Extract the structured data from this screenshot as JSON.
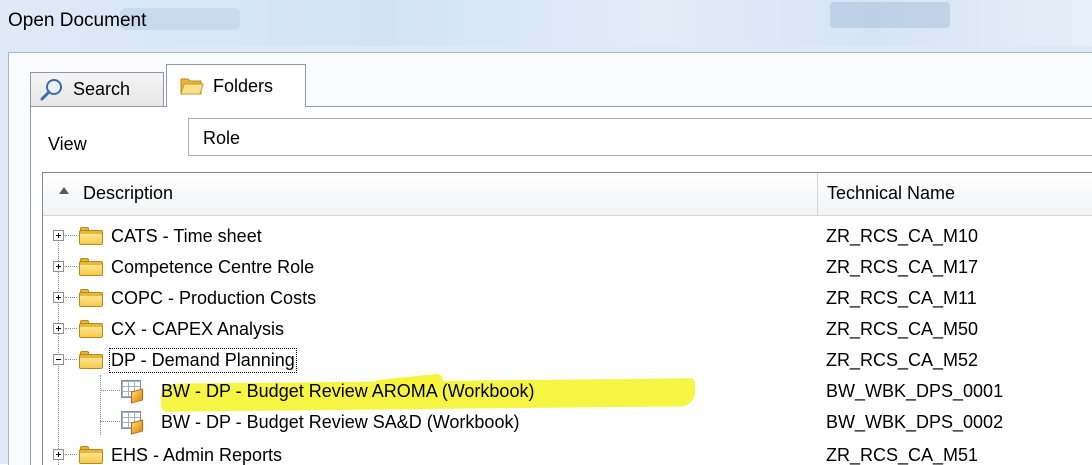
{
  "window": {
    "title": "Open Document"
  },
  "tabs": [
    {
      "label": "Search",
      "icon": "search-icon"
    },
    {
      "label": "Folders",
      "icon": "folder-open-icon",
      "selected": true
    }
  ],
  "view": {
    "label": "View",
    "value": "Role"
  },
  "list": {
    "columns": {
      "description": "Description",
      "technical_name": "Technical Name",
      "sort": "ascending"
    },
    "rows": [
      {
        "description": "CATS - Time sheet",
        "technical_name": "ZR_RCS_CA_M10",
        "type": "folder",
        "expanded": false
      },
      {
        "description": "Competence Centre Role",
        "technical_name": "ZR_RCS_CA_M17",
        "type": "folder",
        "expanded": false
      },
      {
        "description": "COPC - Production Costs",
        "technical_name": "ZR_RCS_CA_M11",
        "type": "folder",
        "expanded": false
      },
      {
        "description": "CX - CAPEX Analysis",
        "technical_name": "ZR_RCS_CA_M50",
        "type": "folder",
        "expanded": false
      },
      {
        "description": "DP - Demand Planning",
        "technical_name": "ZR_RCS_CA_M52",
        "type": "folder",
        "expanded": true,
        "focused": true
      },
      {
        "description": "BW - DP - Budget Review AROMA (Workbook)",
        "technical_name": "BW_WBK_DPS_0001",
        "type": "workbook",
        "highlighted": true
      },
      {
        "description": "BW - DP - Budget Review SA&D (Workbook)",
        "technical_name": "BW_WBK_DPS_0002",
        "type": "workbook"
      },
      {
        "description": "EHS - Admin Reports",
        "technical_name": "ZR_RCS_CA_M51",
        "type": "folder",
        "expanded": false
      }
    ]
  },
  "colors": {
    "highlight": "#f7f43a",
    "folder": "#e8b738",
    "title_bar": "#dfeaf6"
  }
}
